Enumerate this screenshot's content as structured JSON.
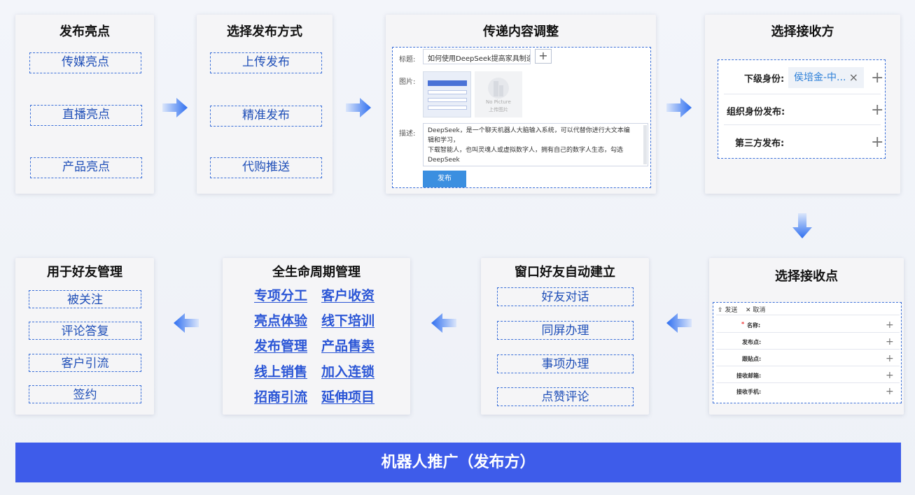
{
  "cards": {
    "publish_highlights": {
      "title": "发布亮点",
      "items": [
        "传媒亮点",
        "直播亮点",
        "产品亮点"
      ]
    },
    "choose_method": {
      "title": "选择发布方式",
      "items": [
        "上传发布",
        "精准发布",
        "代购推送"
      ]
    },
    "content_adjust": {
      "title": "传递内容调整",
      "form": {
        "title_label": "标题:",
        "title_value": "如何使用DeepSeek提高家具制造",
        "image_label": "图片:",
        "placeholder_en": "No Picture",
        "placeholder_cn": "上传图片",
        "desc_label": "描述:",
        "desc_lines": [
          "DeepSeek，是一个聊天机器人大脑输入系统，可以代替你进行大文本编",
          "辑和学习，",
          "下载智能人，也叫灵魂人或虚拟数字人，拥有自己的数字人生态，勾选",
          "DeepSeek"
        ],
        "publish_button": "发布"
      }
    },
    "choose_receiver": {
      "title": "选择接收方",
      "rows": [
        {
          "label": "下级身份:",
          "tag": "侯培金-中...",
          "tag_close": "×"
        },
        {
          "label": "组织身份发布:"
        },
        {
          "label": "第三方发布:"
        }
      ]
    },
    "choose_point": {
      "title": "选择接收点",
      "toolbar": {
        "send": "发送",
        "cancel": "取消"
      },
      "required_mark": "*",
      "rows": [
        "名称:",
        "发布点:",
        "跟贴点:",
        "接收邮箱:",
        "接收手机:"
      ]
    },
    "window_friends": {
      "title": "窗口好友自动建立",
      "items": [
        "好友对话",
        "同屏办理",
        "事项办理",
        "点赞评论"
      ]
    },
    "lifecycle": {
      "title": "全生命周期管理",
      "links": [
        [
          "专项分工",
          "客户收资"
        ],
        [
          "亮点体验",
          "线下培训"
        ],
        [
          "发布管理",
          "产品售卖"
        ],
        [
          "线上销售",
          "加入连锁"
        ],
        [
          "招商引流",
          "延伸项目"
        ]
      ]
    },
    "friend_management": {
      "title": "用于好友管理",
      "items": [
        "被关注",
        "评论答复",
        "客户引流",
        "签约"
      ]
    }
  },
  "footer": {
    "label": "机器人推广（发布方）"
  },
  "colors": {
    "accent": "#3e5cea",
    "dash_border": "#3a6fd8",
    "link_blue": "#2b56d6",
    "arrow_start": "#dbe6fb",
    "arrow_end": "#2f6ff0"
  }
}
